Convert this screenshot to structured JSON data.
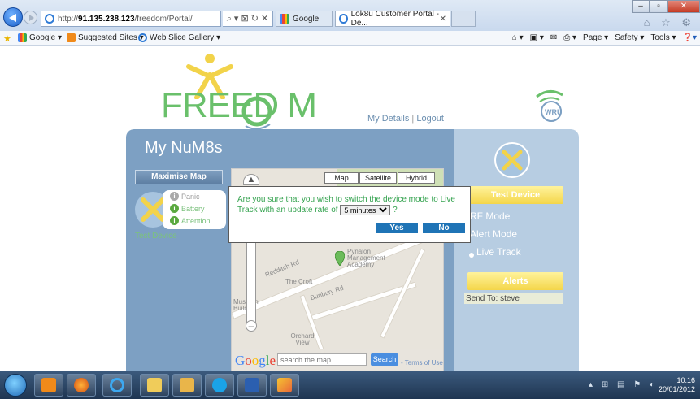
{
  "browser": {
    "address_prefix": "http://",
    "address_host": "91.135.238.123",
    "address_path": "/freedom/Portal/",
    "address_tools": "⌕ ▾ ⊠ ↻ ✕",
    "tabs": [
      {
        "label": "Google"
      },
      {
        "label": "Lok8u Customer Portal - De...",
        "close": "✕"
      }
    ],
    "window_buttons": {
      "minimize": "–",
      "maximize": "▫",
      "close": "✕"
    },
    "toolbar_icons": "⌂ ☆ ⚙"
  },
  "favorites_bar": {
    "items": [
      {
        "label": "Google ▾"
      },
      {
        "label": "Suggested Sites ▾"
      },
      {
        "label": "Web Slice Gallery ▾"
      }
    ],
    "commands": [
      "Page ▾",
      "Safety ▾",
      "Tools ▾"
    ]
  },
  "page": {
    "logo_text": "FREED  M",
    "nav": {
      "my_details": "My Details",
      "separator": "|",
      "logout": "Logout"
    },
    "wru_text": "WRU",
    "title": "My NuM8s",
    "maximise_map": "Maximise Map",
    "device": {
      "name": "Test Device",
      "indicators": [
        {
          "label": "Panic",
          "color": "#a9a9a9"
        },
        {
          "label": "Battery",
          "color": "#5aa93f"
        },
        {
          "label": "Attention",
          "color": "#5aa93f"
        }
      ]
    },
    "map": {
      "types": [
        "Map",
        "Satellite",
        "Hybrid"
      ],
      "labels": [
        "Redditch Rd",
        "The Croft",
        "Bunbury Rd",
        "Pynalon Management Academy",
        "Museum Building",
        "Orchard View"
      ],
      "search_placeholder": "search the map",
      "search_button": "Search",
      "google_logo": "Google",
      "terms": "- Terms of Use",
      "zoom_in": "+",
      "zoom_out": "–"
    },
    "right_panel": {
      "test_device": "Test Device",
      "modes": [
        "RF Mode",
        "Alert Mode",
        "Live Track"
      ],
      "selected_mode": "Live Track",
      "alerts": "Alerts",
      "send_to": "Send To: steve"
    },
    "dialog": {
      "message_part1": "Are you sure that you wish to switch the device mode to Live Track with an update rate of",
      "rate_value": "5 minutes",
      "message_part2": "?",
      "yes": "Yes",
      "no": "No"
    }
  },
  "taskbar": {
    "time": "10:16",
    "date": "20/01/2012"
  },
  "colors": {
    "brand_green": "#6ac06b",
    "panel_blue": "#7da0c3",
    "panel_light": "#b7cde2",
    "button_yellow": "#f4d64a",
    "dialog_button": "#1f74b6"
  }
}
